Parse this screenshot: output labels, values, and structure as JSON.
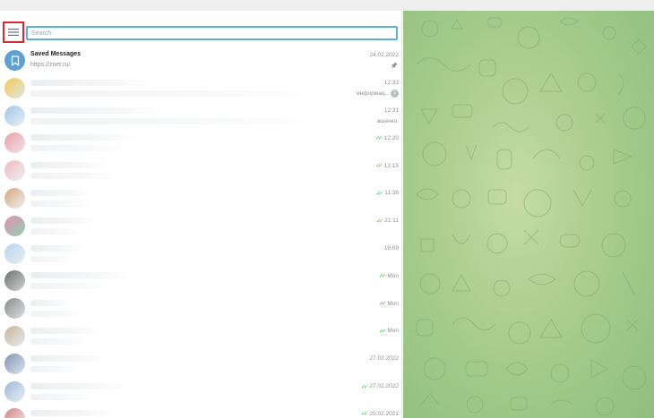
{
  "search": {
    "placeholder": "Search"
  },
  "icons": {
    "menu": "hamburger-menu-icon",
    "saved": "bookmark-icon",
    "pin": "pin-icon",
    "read": "double-check-icon"
  },
  "colors": {
    "accent": "#5fb0dc",
    "highlight_border": "#e0262f",
    "read_check": "#4dbf5c",
    "background_pattern": "#a9cd8c"
  },
  "chats": [
    {
      "name": "Saved Messages",
      "preview": "https://znet.ru/",
      "time": "24.02.2022",
      "pinned": true
    },
    {
      "name": "",
      "preview": "",
      "preview_right": "информац...",
      "time": "12:33",
      "unread": "1"
    },
    {
      "name": "",
      "preview": "",
      "preview_right": "ашенко.",
      "time": "12:31"
    },
    {
      "name": "",
      "preview": "",
      "time": "12:20",
      "read": true
    },
    {
      "name": "",
      "preview": "",
      "time": "12:15",
      "read": true
    },
    {
      "name": "",
      "preview": "",
      "time": "11:36",
      "read": true
    },
    {
      "name": "",
      "preview": "",
      "time": "21:11",
      "read": true
    },
    {
      "name": "",
      "preview": "",
      "time": "19:09"
    },
    {
      "name": "",
      "preview": "",
      "time": "Mon",
      "read": true
    },
    {
      "name": "",
      "preview": "",
      "time": "Mon",
      "read": true
    },
    {
      "name": "",
      "preview": "",
      "time": "Mon",
      "read": true
    },
    {
      "name": "",
      "preview": "",
      "time": "27.02.2022"
    },
    {
      "name": "",
      "preview": "",
      "time": "27.02.2022",
      "read": true
    },
    {
      "name": "",
      "preview": "",
      "time": "25.02.2022",
      "read": true
    }
  ]
}
